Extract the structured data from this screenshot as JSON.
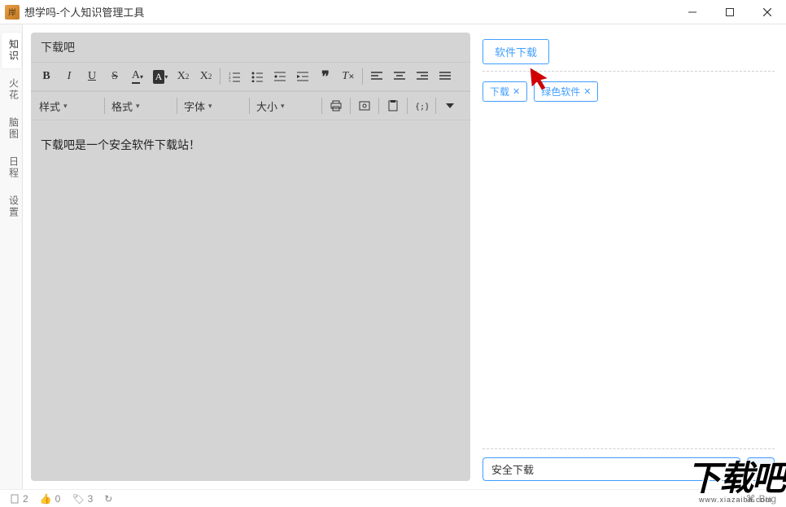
{
  "titlebar": {
    "title": "想学吗-个人知识管理工具"
  },
  "sidebar": {
    "items": [
      {
        "label": "知识",
        "active": true
      },
      {
        "label": "火花",
        "active": false
      },
      {
        "label": "脑图",
        "active": false
      },
      {
        "label": "日程",
        "active": false
      },
      {
        "label": "设置",
        "active": false
      }
    ]
  },
  "editor": {
    "doc_title": "下载吧",
    "body": "下载吧是一个安全软件下载站！",
    "selects": {
      "style": "样式",
      "format": "格式",
      "font": "字体",
      "size": "大小"
    }
  },
  "right": {
    "category": "软件下载",
    "tags": [
      {
        "label": "下载"
      },
      {
        "label": "绿色软件"
      }
    ],
    "tag_input_value": "安全下载",
    "add_label": "+"
  },
  "statusbar": {
    "docs": "2",
    "favorites": "0",
    "tags": "3",
    "bug": "Bug"
  },
  "watermark": {
    "text": "下载吧",
    "url": "www.xiazaiba.com"
  }
}
